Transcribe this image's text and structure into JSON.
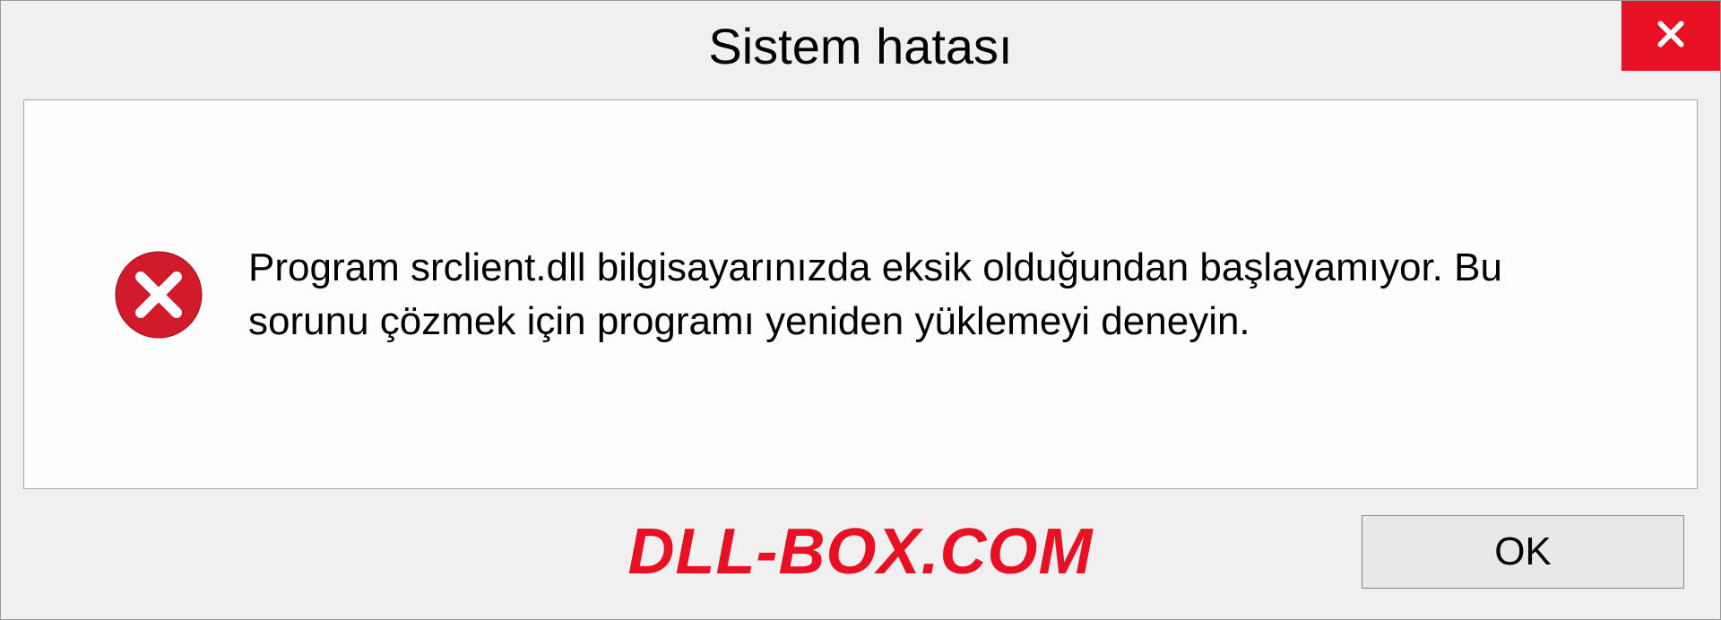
{
  "dialog": {
    "title": "Sistem hatası",
    "message": "Program srclient.dll bilgisayarınızda eksik olduğundan başlayamıyor. Bu sorunu çözmek için programı yeniden yüklemeyi deneyin.",
    "ok_label": "OK",
    "watermark": "DLL-BOX.COM"
  },
  "colors": {
    "close_bg": "#e81123",
    "watermark": "#e81123",
    "error_icon_fill": "#d11a2a"
  }
}
